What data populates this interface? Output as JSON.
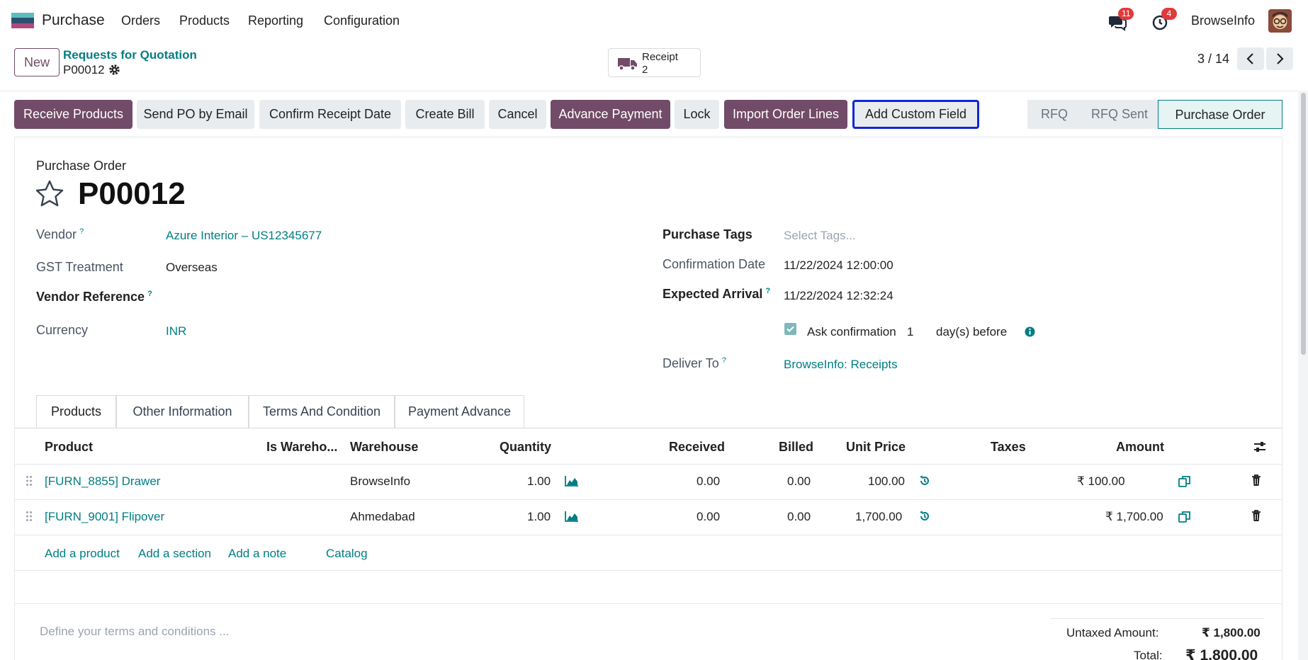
{
  "navbar": {
    "app_name": "Purchase",
    "menu": [
      "Orders",
      "Products",
      "Reporting",
      "Configuration"
    ],
    "messages_count": "11",
    "activities_count": "4",
    "company": "BrowseInfo"
  },
  "control": {
    "new_label": "New",
    "breadcrumb_parent": "Requests for Quotation",
    "breadcrumb_current": "P00012",
    "smart_button": {
      "label": "Receipt",
      "value": "2"
    },
    "pager": "3 / 14"
  },
  "actions": [
    "Receive Products",
    "Send PO by Email",
    "Confirm Receipt Date",
    "Create Bill",
    "Cancel",
    "Advance Payment",
    "Lock",
    "Import Order Lines",
    "Add Custom Field"
  ],
  "status": [
    "RFQ",
    "RFQ Sent",
    "Purchase Order"
  ],
  "form": {
    "doc_type": "Purchase Order",
    "name": "P00012",
    "vendor_label": "Vendor",
    "vendor": "Azure Interior – US12345677",
    "gst_label": "GST Treatment",
    "gst": "Overseas",
    "vendor_ref_label": "Vendor Reference",
    "currency_label": "Currency",
    "currency": "INR",
    "tags_label": "Purchase Tags",
    "tags_placeholder": "Select Tags...",
    "confirmation_label": "Confirmation Date",
    "confirmation": "11/22/2024 12:00:00",
    "arrival_label": "Expected Arrival",
    "arrival": "11/22/2024 12:32:24",
    "ask_confirmation": "Ask confirmation",
    "ask_days": "1",
    "ask_suffix": "day(s) before",
    "deliver_label": "Deliver To",
    "deliver": "BrowseInfo: Receipts"
  },
  "tabs": [
    "Products",
    "Other Information",
    "Terms And Condition",
    "Payment Advance"
  ],
  "table": {
    "headers": {
      "product": "Product",
      "is_warehouse": "Is Wareho...",
      "warehouse": "Warehouse",
      "quantity": "Quantity",
      "received": "Received",
      "billed": "Billed",
      "unit_price": "Unit Price",
      "taxes": "Taxes",
      "amount": "Amount"
    },
    "rows": [
      {
        "product": "[FURN_8855] Drawer",
        "warehouse": "BrowseInfo",
        "quantity": "1.00",
        "received": "0.00",
        "billed": "0.00",
        "unit_price": "100.00",
        "amount": "₹ 100.00"
      },
      {
        "product": "[FURN_9001] Flipover",
        "warehouse": "Ahmedabad",
        "quantity": "1.00",
        "received": "0.00",
        "billed": "0.00",
        "unit_price": "1,700.00",
        "amount": "₹ 1,700.00"
      }
    ],
    "add_links": [
      "Add a product",
      "Add a section",
      "Add a note",
      "Catalog"
    ]
  },
  "footer": {
    "terms_placeholder": "Define your terms and conditions ...",
    "untaxed_label": "Untaxed Amount:",
    "untaxed": "₹ 1,800.00",
    "total_label": "Total:",
    "total": "₹ 1,800.00"
  },
  "colors": {
    "primary": "#714b67",
    "link": "#017e84",
    "highlight_border": "#1126d6"
  }
}
